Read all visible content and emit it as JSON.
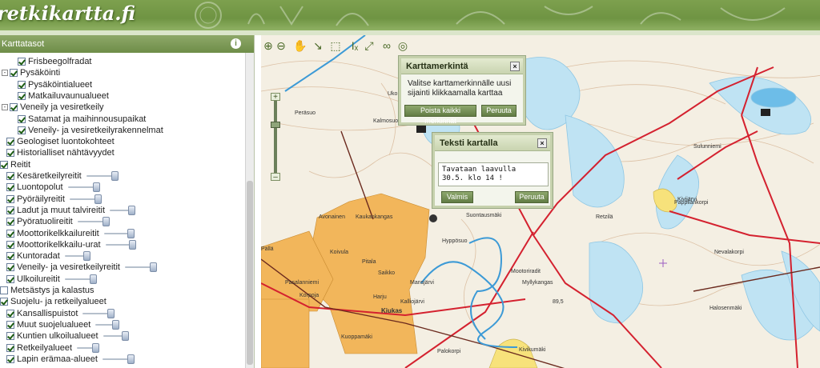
{
  "header": {
    "logo_text": "retkikartta.fi"
  },
  "sidebar": {
    "title": "Karttatasot",
    "info_icon": "i",
    "items": [
      {
        "label": "Frisbeegolfradat",
        "checked": true,
        "indent": 2,
        "twisty": "",
        "slider": false
      },
      {
        "label": "Pysäköinti",
        "checked": true,
        "indent": 0,
        "twisty": "-",
        "slider": false
      },
      {
        "label": "Pysäköintialueet",
        "checked": true,
        "indent": 2,
        "twisty": "",
        "slider": false
      },
      {
        "label": "Matkailuvaunualueet",
        "checked": true,
        "indent": 2,
        "twisty": "",
        "slider": false
      },
      {
        "label": "Veneily ja vesiretkeily",
        "checked": true,
        "indent": 0,
        "twisty": "-",
        "slider": false
      },
      {
        "label": "Satamat ja maihinnousupaikat",
        "checked": true,
        "indent": 2,
        "twisty": "",
        "slider": false
      },
      {
        "label": "Veneily- ja vesiretkeilyrakennelmat",
        "checked": true,
        "indent": 2,
        "twisty": "",
        "slider": false
      },
      {
        "label": "Geologiset luontokohteet",
        "checked": true,
        "indent": 1,
        "twisty": "",
        "slider": false
      },
      {
        "label": "Historialliset nähtävyydet",
        "checked": true,
        "indent": 1,
        "twisty": "",
        "slider": false
      },
      {
        "label": "Reitit",
        "checked": true,
        "indent": -1,
        "twisty": "",
        "slider": false
      },
      {
        "label": "Kesäretkeilyreitit",
        "checked": true,
        "indent": 1,
        "twisty": "",
        "slider": true
      },
      {
        "label": "Luontopolut",
        "checked": true,
        "indent": 1,
        "twisty": "",
        "slider": true
      },
      {
        "label": "Pyöräilyreitit",
        "checked": true,
        "indent": 1,
        "twisty": "",
        "slider": true
      },
      {
        "label": "Ladut ja muut talvireitit",
        "checked": true,
        "indent": 1,
        "twisty": "",
        "slider": true
      },
      {
        "label": "Pyöratuolireitit",
        "checked": true,
        "indent": 1,
        "twisty": "",
        "slider": true
      },
      {
        "label": "Moottorikelkkailureitit",
        "checked": true,
        "indent": 1,
        "twisty": "",
        "slider": true
      },
      {
        "label": "Moottorikelkkailu-urat",
        "checked": true,
        "indent": 1,
        "twisty": "",
        "slider": true
      },
      {
        "label": "Kuntoradat",
        "checked": true,
        "indent": 1,
        "twisty": "",
        "slider": true
      },
      {
        "label": "Veneily- ja vesiretkeilyreitit",
        "checked": true,
        "indent": 1,
        "twisty": "",
        "slider": true
      },
      {
        "label": "Ulkoilureitit",
        "checked": true,
        "indent": 1,
        "twisty": "",
        "slider": true
      },
      {
        "label": "Metsästys ja kalastus",
        "checked": false,
        "indent": -1,
        "twisty": "",
        "slider": false
      },
      {
        "label": "Suojelu- ja retkeilyalueet",
        "checked": true,
        "indent": -1,
        "twisty": "",
        "slider": false
      },
      {
        "label": "Kansallispuistot",
        "checked": true,
        "indent": 1,
        "twisty": "",
        "slider": true
      },
      {
        "label": "Muut suojelualueet",
        "checked": true,
        "indent": 1,
        "twisty": "",
        "slider": true
      },
      {
        "label": "Kuntien ulkoilualueet",
        "checked": true,
        "indent": 1,
        "twisty": "",
        "slider": true
      },
      {
        "label": "Retkeilyalueet",
        "checked": true,
        "indent": 1,
        "twisty": "",
        "slider": true
      },
      {
        "label": "Lapin erämaa-alueet",
        "checked": true,
        "indent": 1,
        "twisty": "",
        "slider": true
      }
    ]
  },
  "toolbar": {
    "tools": [
      "zoom-in-icon",
      "zoom-out-icon",
      "pan-hand-icon",
      "measure-icon",
      "select-icon",
      "text-icon",
      "export-icon",
      "link-icon",
      "marker-icon"
    ]
  },
  "map_labels": [
    "Ukonkangas",
    "Kalmosuo",
    "Peräsuo",
    "Kiukas",
    "Saikko",
    "Pitala",
    "Pällä",
    "Koivula",
    "Pasalanniemi",
    "Korpoja",
    "Harju",
    "Kalliojärvi",
    "Mansjärvi",
    "Myllykangas",
    "Suontausmäki",
    "Kivijärvi",
    "Pappilankorpi",
    "Sulunniemi",
    "Nevalakorpi",
    "Halosenmäki",
    "Kuoppamäki",
    "Palokorpi",
    "Kivikumäki",
    "Retzilä",
    "Avonainen",
    "Kaukankangas",
    "Hyppösuo",
    "Mootoriradit",
    "89,5"
  ],
  "dialog_marker": {
    "title": "Karttamerkintä",
    "body": "Valitse karttamerkinnälle uusi sijainti klikkaamalla karttaa",
    "remove_all": "Poista kaikki merkinnät",
    "cancel": "Peruuta"
  },
  "dialog_text": {
    "title": "Teksti kartalla",
    "text_value": "Tavataan laavulla\n30.5. klo 14 !",
    "ok": "Valmis",
    "cancel": "Peruuta"
  },
  "colors": {
    "header_green": "#7da04e",
    "route_red": "#d4212f",
    "water_blue": "#3c9ad6",
    "settlement_orange": "#f2b65b",
    "field_yellow": "#f7e27b",
    "terrain_contour": "#d7b59a"
  }
}
